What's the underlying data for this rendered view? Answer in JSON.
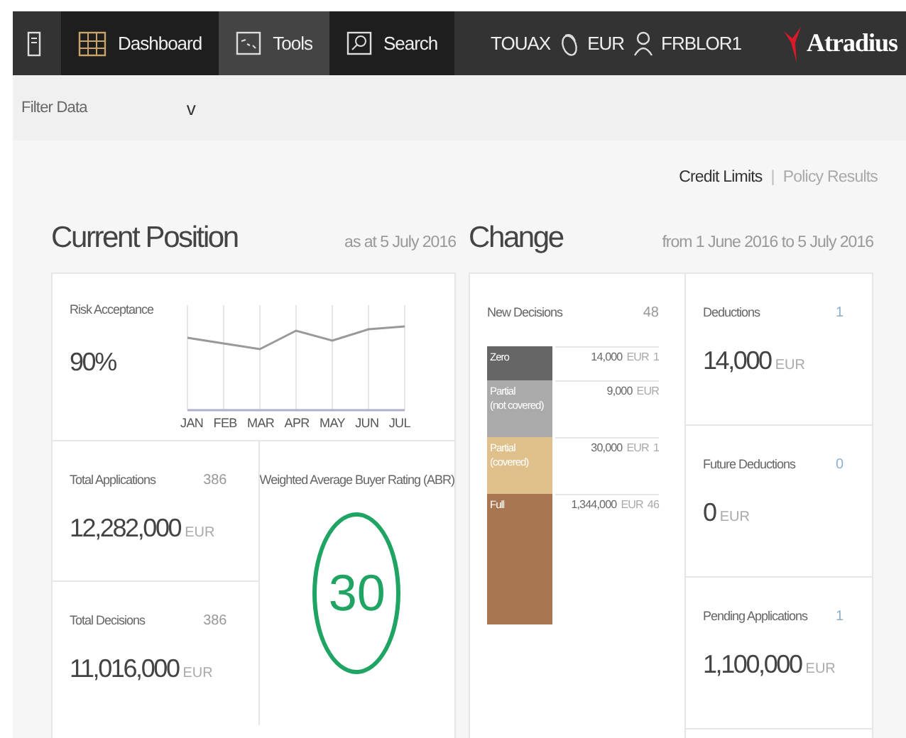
{
  "nav": {
    "tabs": [
      {
        "label": "Dashboard",
        "kind": "grid",
        "selected": true
      },
      {
        "label": "Tools",
        "kind": "chart",
        "selected": false
      },
      {
        "label": "Search",
        "kind": "search",
        "selected": true
      }
    ],
    "company": "TOUAX",
    "currency": "EUR",
    "user": "FRBLOR1",
    "logo": "Atradius"
  },
  "filter": {
    "label": "Filter Data",
    "caret": "v"
  },
  "views_separator": "|",
  "views": [
    {
      "label": "Credit Limits",
      "selected": true
    },
    {
      "label": "Policy Results",
      "selected": false
    }
  ],
  "current": {
    "title": "Current Position",
    "date": "as at 5 July 2016",
    "risk": {
      "label": "Risk Acceptance",
      "value": "90%",
      "months": [
        "JAN",
        "FEB",
        "MAR",
        "APR",
        "MAY",
        "JUN",
        "JUL"
      ]
    },
    "applications": {
      "label": "Total Applications",
      "count": "386",
      "amount": "12,282,000",
      "unit": "EUR"
    },
    "decisions": {
      "label": "Total Decisions",
      "count": "386",
      "amount": "11,016,000",
      "unit": "EUR"
    },
    "rating": {
      "label": "Weighted Average Buyer Rating (ABR)",
      "value": "30"
    }
  },
  "change": {
    "title": "Change",
    "date": "from 1 June 2016 to 5 July 2016",
    "new_decisions": {
      "label": "New Decisions",
      "count": "48",
      "rows": [
        {
          "label": "Zero",
          "color": "#666666",
          "amount": "14,000",
          "unit": "EUR",
          "count": "1"
        },
        {
          "label": "Partial\n(not covered)",
          "color": "#aaaaaa",
          "amount": "9,000",
          "unit": "EUR"
        },
        {
          "label": "Partial\n(covered)",
          "color": "#dfc08b",
          "amount": "30,000",
          "unit": "EUR",
          "count": "1"
        },
        {
          "label": "Full",
          "color": "#a87650",
          "amount": "1,344,000",
          "unit": "EUR",
          "count": "46"
        }
      ]
    },
    "stats": [
      {
        "label": "Deductions",
        "count": "1",
        "amount": "14,000",
        "unit": "EUR"
      },
      {
        "label": "Future Deductions",
        "count": "0",
        "amount": "0",
        "unit": "EUR"
      },
      {
        "label": "Pending Applications",
        "count": "1",
        "amount": "1,100,000",
        "unit": "EUR"
      }
    ]
  }
}
